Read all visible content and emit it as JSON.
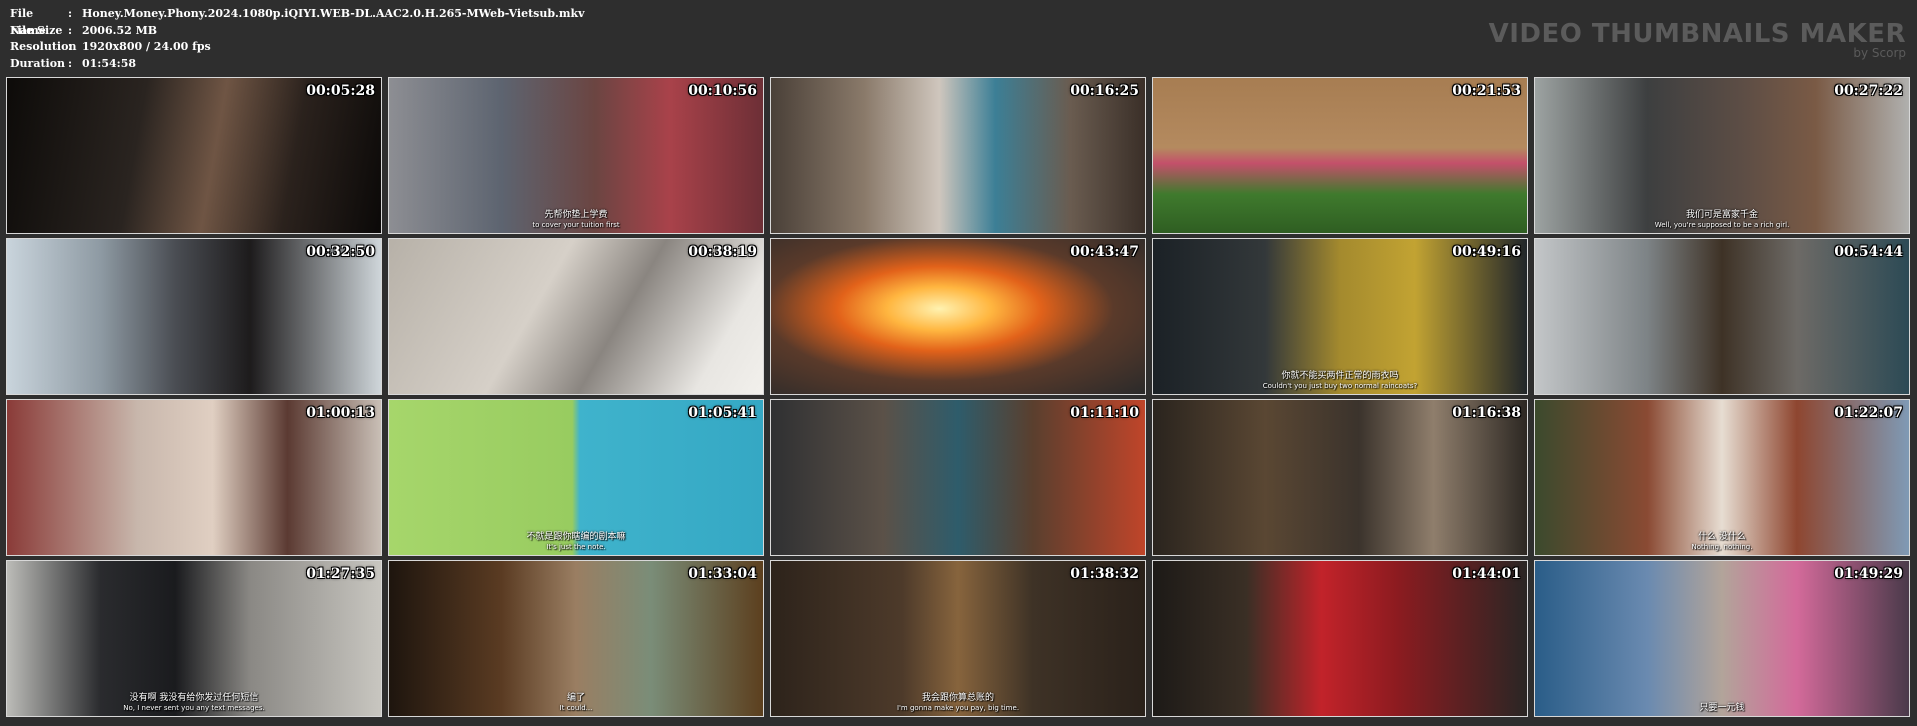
{
  "file_info": [
    {
      "label": "File Name",
      "value": "Honey.Money.Phony.2024.1080p.iQIYI.WEB-DL.AAC2.0.H.265-MWeb-Vietsub.mkv"
    },
    {
      "label": "File Size",
      "value": "2006.52 MB"
    },
    {
      "label": "Resolution",
      "value": "1920x800 / 24.00 fps"
    },
    {
      "label": "Duration",
      "value": "01:54:58"
    }
  ],
  "brand": {
    "title": "VIDEO THUMBNAILS MAKER",
    "subtitle": "by Scorp"
  },
  "thumbnails": [
    {
      "timestamp": "00:05:28",
      "sub_cn": "",
      "sub_en": "",
      "bg": "linear-gradient(100deg,#0d0b09 0%,#2a2420 35%,#6f5544 55%,#2b221d 75%,#0b0908 100%)"
    },
    {
      "timestamp": "00:10:56",
      "sub_cn": "先帮你垫上学费",
      "sub_en": "to cover your tuition first",
      "bg": "linear-gradient(90deg,#8d8e93 0%,#5d6470 30%,#6b4542 55%,#a9424a 75%,#6d2f36 100%)"
    },
    {
      "timestamp": "00:16:25",
      "sub_cn": "",
      "sub_en": "",
      "bg": "linear-gradient(90deg,#4a4038 0%,#8a7a6a 25%,#cfc6bd 45%,#3c7f96 60%,#6a5c50 80%,#3a2f28 100%)"
    },
    {
      "timestamp": "00:21:53",
      "sub_cn": "",
      "sub_en": "",
      "bg": "linear-gradient(180deg,#a77d52 0%,#b48a5f 45%,#c4506a 55%,#3f7a2d 75%,#2f5e22 100%)"
    },
    {
      "timestamp": "00:27:22",
      "sub_cn": "我们可是富家千金",
      "sub_en": "Well, you're supposed to be a rich girl.",
      "bg": "linear-gradient(90deg,#9da3a2 0%,#3d3f40 30%,#5c4d45 55%,#7a5a45 75%,#b0b0ae 100%)"
    },
    {
      "timestamp": "00:32:50",
      "sub_cn": "",
      "sub_en": "",
      "bg": "linear-gradient(90deg,#c9d4dc 0%,#8e9aa3 25%,#4a4d53 45%,#1d1b1c 65%,#cfd6da 100%)"
    },
    {
      "timestamp": "00:38:19",
      "sub_cn": "",
      "sub_en": "",
      "bg": "linear-gradient(120deg,#b7b1a8 0%,#d6d0c8 40%,#8a8580 60%,#e8e6e2 85%,#f2f0ec 100%)"
    },
    {
      "timestamp": "00:43:47",
      "sub_cn": "",
      "sub_en": "",
      "bg": "radial-gradient(ellipse at 45% 45%,#fff2b0 0%,#ffb640 18%,#e2621a 35%,#5a3a2a 60%,#2a2a2a 100%)"
    },
    {
      "timestamp": "00:49:16",
      "sub_cn": "你就不能买两件正常的雨衣吗",
      "sub_en": "Couldn't you just buy two normal raincoats?",
      "bg": "linear-gradient(90deg,#1b2126 0%,#33383a 30%,#a48a2e 50%,#c2a332 70%,#21262a 100%)"
    },
    {
      "timestamp": "00:54:44",
      "sub_cn": "",
      "sub_en": "",
      "bg": "linear-gradient(90deg,#c3c6c8 0%,#7d8386 30%,#3e3226 50%,#6d6a66 70%,#2c4a55 100%)"
    },
    {
      "timestamp": "01:00:13",
      "sub_cn": "",
      "sub_en": "",
      "bg": "linear-gradient(90deg,#8a3b38 0%,#c8b7ac 35%,#e0cfc2 55%,#5b3a32 75%,#c9bfb6 100%)"
    },
    {
      "timestamp": "01:05:41",
      "sub_cn": "不就是跟你瞎编的剧本嘛",
      "sub_en": "It's just the note.",
      "bg": "linear-gradient(90deg,#a6d66b 0%,#98cc60 49%,#3fb3cc 51%,#35a8c4 100%)"
    },
    {
      "timestamp": "01:11:10",
      "sub_cn": "",
      "sub_en": "",
      "bg": "linear-gradient(90deg,#2f3032 0%,#5b5148 30%,#2e5c6b 50%,#5a3f2e 70%,#c0452a 100%)"
    },
    {
      "timestamp": "01:16:38",
      "sub_cn": "",
      "sub_en": "",
      "bg": "linear-gradient(90deg,#2a241e 0%,#5a4733 30%,#3b332c 55%,#8f7e6c 75%,#2d2823 100%)"
    },
    {
      "timestamp": "01:22:07",
      "sub_cn": "什么 没什么",
      "sub_en": "Nothing, nothing.",
      "bg": "linear-gradient(90deg,#3b4a2d 0%,#8a4a33 30%,#e7ddd2 50%,#8e4630 70%,#7f9ab5 100%)"
    },
    {
      "timestamp": "01:27:35",
      "sub_cn": "没有啊 我没有给你发过任何短信",
      "sub_en": "No, I never sent you any text messages.",
      "bg": "linear-gradient(90deg,#bcbcb8 0%,#2a2b2e 25%,#1a1b1e 45%,#8a8884 65%,#c8c6c0 100%)"
    },
    {
      "timestamp": "01:33:04",
      "sub_cn": "编了",
      "sub_en": "It could...",
      "bg": "linear-gradient(90deg,#1e150e 0%,#5a3b22 30%,#9a7e62 50%,#7a8d78 70%,#5c3f1e 100%)"
    },
    {
      "timestamp": "01:38:32",
      "sub_cn": "我会跟你算总账的",
      "sub_en": "I'm gonna make you pay, big time.",
      "bg": "linear-gradient(90deg,#2d231b 0%,#4d3a2a 35%,#87643d 50%,#3e3226 70%,#2a211a 100%)"
    },
    {
      "timestamp": "01:44:01",
      "sub_cn": "",
      "sub_en": "",
      "bg": "linear-gradient(90deg,#1d1a17 0%,#3a2f25 25%,#c2232a 45%,#8d1b20 65%,#2a2624 100%)"
    },
    {
      "timestamp": "01:49:29",
      "sub_cn": "只要一元钱",
      "sub_en": "",
      "bg": "linear-gradient(90deg,#2a5d88 0%,#6a8ab0 30%,#b2a49a 50%,#d36a9a 70%,#4a3a4a 100%)"
    }
  ]
}
